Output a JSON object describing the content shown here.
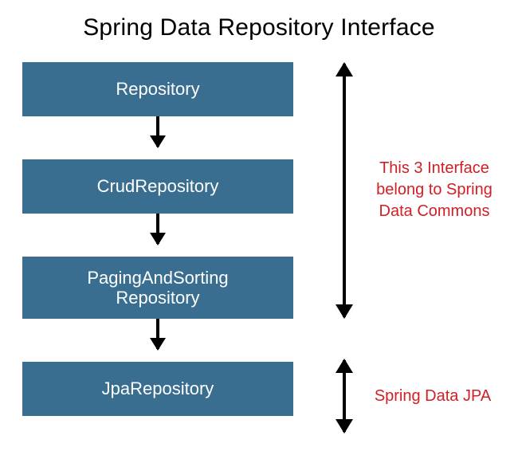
{
  "title": "Spring Data Repository Interface",
  "boxes": {
    "b1": "Repository",
    "b2": "CrudRepository",
    "b3": "PagingAndSorting\nRepository",
    "b4": "JpaRepository"
  },
  "annotations": {
    "a1": "This 3 Interface\nbelong to Spring\nData Commons",
    "a2": "Spring Data JPA"
  },
  "colors": {
    "box_bg": "#3A6E91",
    "annot_color": "#D11F25"
  }
}
